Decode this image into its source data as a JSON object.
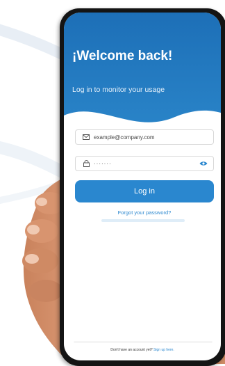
{
  "login_screen": {
    "title": "¡Welcome back!",
    "subtitle": "Log in to monitor your usage",
    "email_value": "example@company.com",
    "password_value": "·······",
    "login_label": "Log in",
    "forgot_label": "Forgot your password?",
    "footer_text": "Don't have an account yet?",
    "footer_link": "Sign up here."
  },
  "colors": {
    "brand_blue": "#2a87cf",
    "header_blue": "#1d6fb7",
    "phone_frame": "#141414"
  },
  "icons": [
    "envelope-icon",
    "lock-icon",
    "eye-icon"
  ]
}
